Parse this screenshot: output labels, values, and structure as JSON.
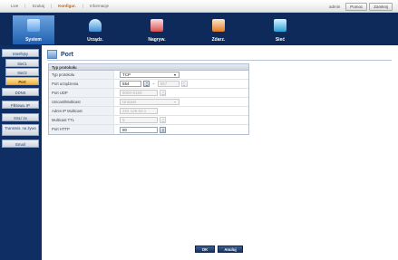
{
  "topmenu": {
    "items": [
      "Live",
      "Szukaj",
      "Konfigur.",
      "Informacje"
    ],
    "active_index": 2
  },
  "topright": {
    "user": "admin",
    "help_label": "Pomoc",
    "logout_label": "Zamknij"
  },
  "tabs": [
    {
      "label": "System",
      "icon": "system-icon",
      "active": true
    },
    {
      "label": "Urządz.",
      "icon": "device-icon",
      "active": false
    },
    {
      "label": "Nagryw.",
      "icon": "record-icon",
      "active": false
    },
    {
      "label": "Zdarz.",
      "icon": "event-icon",
      "active": false
    },
    {
      "label": "Sieć",
      "icon": "network-icon",
      "active": false
    }
  ],
  "sidebar": {
    "items": [
      {
        "label": "Interfejsy",
        "level": 0
      },
      {
        "label": "Sieć1",
        "level": 1
      },
      {
        "label": "Sieć2",
        "level": 1
      },
      {
        "label": "Port",
        "level": 1,
        "active": true
      },
      {
        "label": "DDNS",
        "level": 0
      },
      {
        "label": "Filtrowa. IP",
        "level": 0
      },
      {
        "label": "SSL/ 2x",
        "level": 0
      },
      {
        "label": "Transmis. na żywo",
        "level": 0
      },
      {
        "label": "Email",
        "level": 0
      }
    ]
  },
  "page": {
    "title": "Port",
    "section_header": "Typ protokołu",
    "rows": [
      {
        "label": "Typ protokołu",
        "value": "TCP"
      },
      {
        "label": "Port urządzenia",
        "value_from": "554",
        "value_to": "557"
      },
      {
        "label": "Port UDP",
        "value_from": "8000-8159"
      },
      {
        "label": "Unicast/Multicast",
        "value": "Unicast"
      },
      {
        "label": "Adres IP Multicast",
        "value": "224.126.63.1"
      },
      {
        "label": "Multicast TTL",
        "value": "5"
      },
      {
        "label": "Port HTTP",
        "value": "80"
      }
    ]
  },
  "buttons": {
    "ok": "OK",
    "cancel": "Anuluj"
  }
}
